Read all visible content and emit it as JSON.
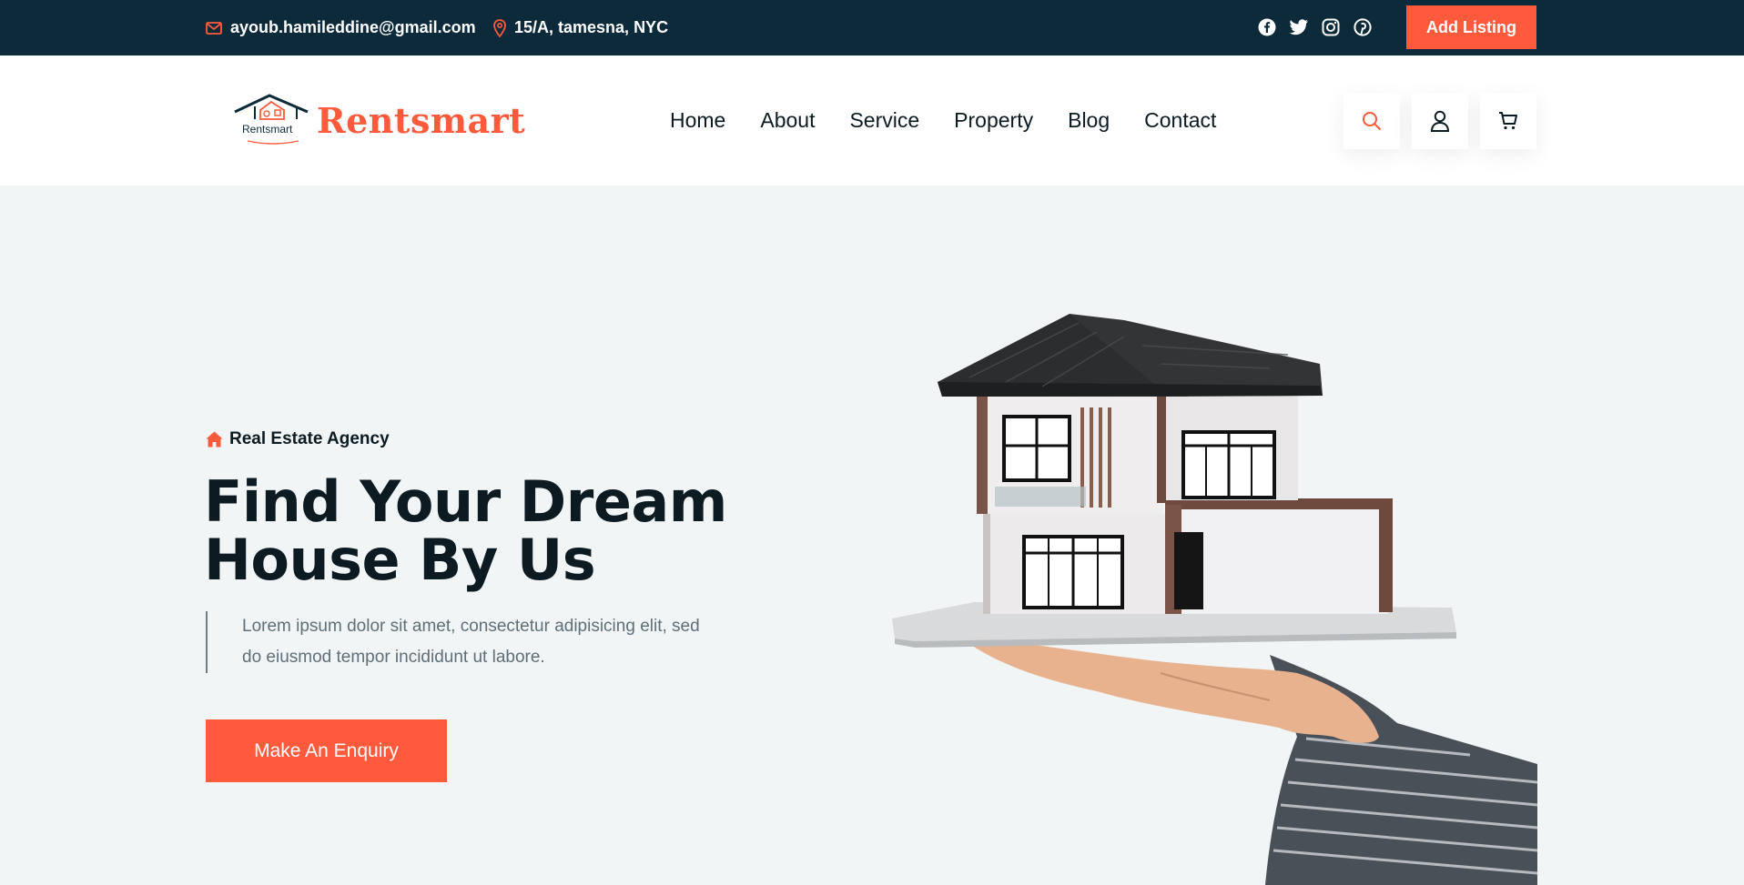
{
  "topbar": {
    "email": "ayoub.hamileddine@gmail.com",
    "address": "15/A, tamesna, NYC",
    "add_listing_label": "Add Listing",
    "social_icons": [
      "facebook-icon",
      "twitter-icon",
      "instagram-icon",
      "pinterest-icon"
    ]
  },
  "header": {
    "logo_text": "Rentsmart",
    "logo_mark_text": "Rentsmart",
    "nav": [
      "Home",
      "About",
      "Service",
      "Property",
      "Blog",
      "Contact"
    ],
    "action_icons": [
      "search-icon",
      "user-icon",
      "cart-icon"
    ]
  },
  "hero": {
    "tag": "Real Estate Agency",
    "title_line1": "Find Your Dream",
    "title_line2": "House By Us",
    "description_line1": "Lorem ipsum dolor sit amet, consectetur adipisicing elit, sed",
    "description_line2": "do eiusmod tempor incididunt ut labore.",
    "cta_label": "Make An Enquiry",
    "image": "house-model-in-hand"
  },
  "colors": {
    "accent": "#ff5a3c",
    "topbar_bg": "#0c2a3a",
    "hero_bg": "#f2f5f6",
    "heading": "#0c1a22"
  }
}
